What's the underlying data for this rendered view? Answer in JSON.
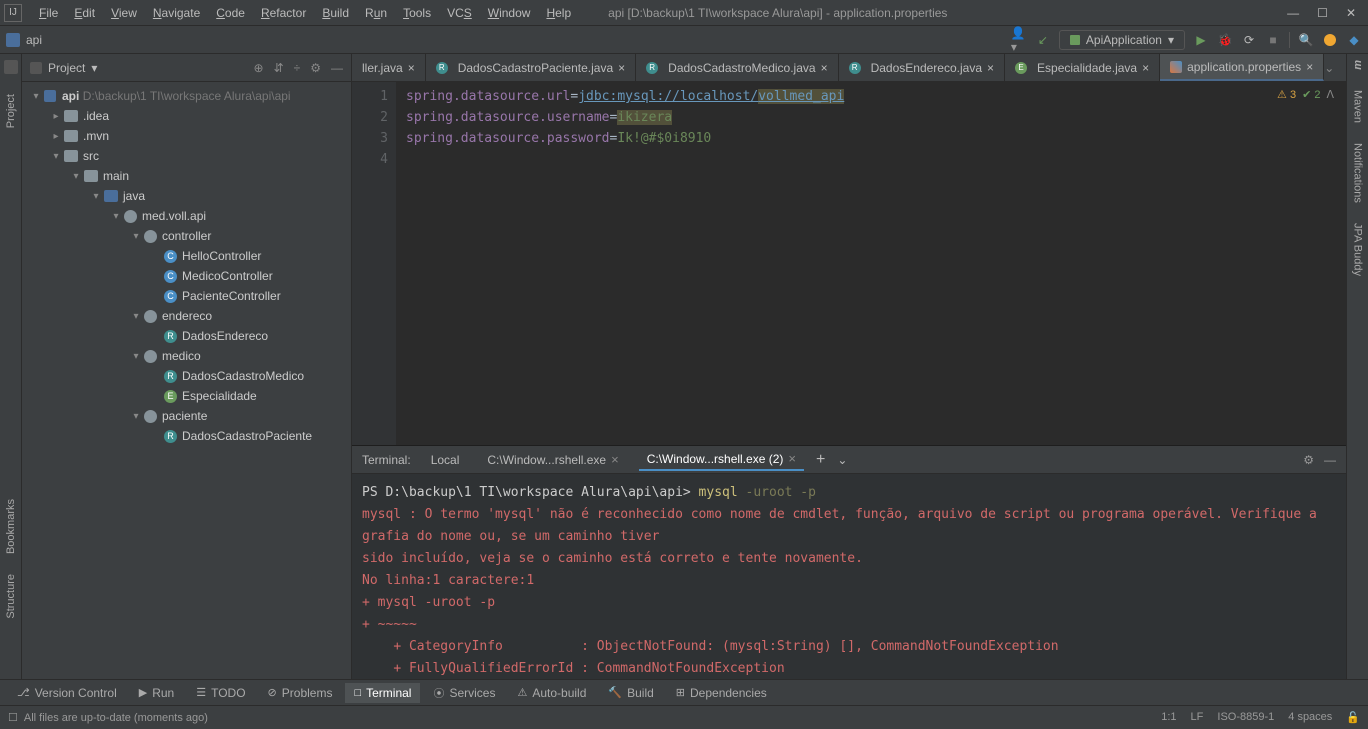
{
  "window": {
    "title": "api [D:\\backup\\1 TI\\workspace Alura\\api] - application.properties",
    "breadcrumb": "api"
  },
  "menu": [
    "File",
    "Edit",
    "View",
    "Navigate",
    "Code",
    "Refactor",
    "Build",
    "Run",
    "Tools",
    "VCS",
    "Window",
    "Help"
  ],
  "runConfig": "ApiApplication",
  "projectPanel": {
    "title": "Project",
    "tree": {
      "root": "api",
      "rootPath": "D:\\backup\\1 TI\\workspace Alura\\api\\api",
      "idea": ".idea",
      "mvn": ".mvn",
      "src": "src",
      "main": "main",
      "java": "java",
      "pkg": "med.voll.api",
      "controller": "controller",
      "hello": "HelloController",
      "medicoCtrl": "MedicoController",
      "pacienteCtrl": "PacienteController",
      "endereco": "endereco",
      "dadosEnd": "DadosEndereco",
      "medico": "medico",
      "dadosMed": "DadosCadastroMedico",
      "espec": "Especialidade",
      "paciente": "paciente",
      "dadosPac": "DadosCadastroPaciente"
    }
  },
  "tabs": [
    {
      "label": "ller.java",
      "icon": "c-blue"
    },
    {
      "label": "DadosCadastroPaciente.java",
      "icon": "c-teal"
    },
    {
      "label": "DadosCadastroMedico.java",
      "icon": "c-teal"
    },
    {
      "label": "DadosEndereco.java",
      "icon": "c-teal"
    },
    {
      "label": "Especialidade.java",
      "icon": "c-green"
    },
    {
      "label": "application.properties",
      "icon": "prop",
      "active": true
    }
  ],
  "editor": {
    "lines": [
      "1",
      "2",
      "3",
      "4"
    ],
    "l1a": "spring.datasource.url",
    "l1b": "jdbc:mysql://localhost/",
    "l1c": "vollmed_api",
    "l2a": "spring.datasource.username",
    "l2b": "ikizera",
    "l3a": "spring.datasource.password",
    "l3b": "Ik!@#$0i8910",
    "inspections": {
      "warn": "3",
      "ok": "2"
    }
  },
  "terminal": {
    "title": "Terminal:",
    "tabs": [
      {
        "label": "Local"
      },
      {
        "label": "C:\\Window...rshell.exe"
      },
      {
        "label": "C:\\Window...rshell.exe (2)",
        "active": true
      }
    ],
    "prompt": "PS D:\\backup\\1 TI\\workspace Alura\\api\\api> ",
    "cmd": "mysql",
    "cmdArgs": " -uroot -p",
    "err1": "mysql : O termo 'mysql' não é reconhecido como nome de cmdlet, função, arquivo de script ou programa operável. Verifique a grafia do nome ou, se um caminho tiver",
    "err2": "sido incluído, veja se o caminho está correto e tente novamente.",
    "err3": "No linha:1 caractere:1",
    "err4": "+ mysql -uroot -p",
    "err5": "+ ~~~~~",
    "err6": "    + CategoryInfo          : ObjectNotFound: (mysql:String) [], CommandNotFoundException",
    "err7": "    + FullyQualifiedErrorId : CommandNotFoundException"
  },
  "bottomTabs": [
    "Version Control",
    "Run",
    "TODO",
    "Problems",
    "Terminal",
    "Services",
    "Auto-build",
    "Build",
    "Dependencies"
  ],
  "statusbar": {
    "left": "All files are up-to-date (moments ago)",
    "pos": "1:1",
    "lf": "LF",
    "enc": "ISO-8859-1",
    "indent": "4 spaces"
  },
  "leftStrip": [
    "Project",
    "Bookmarks",
    "Structure"
  ],
  "rightStrip": [
    "Maven",
    "Notifications",
    "JPA Buddy"
  ]
}
